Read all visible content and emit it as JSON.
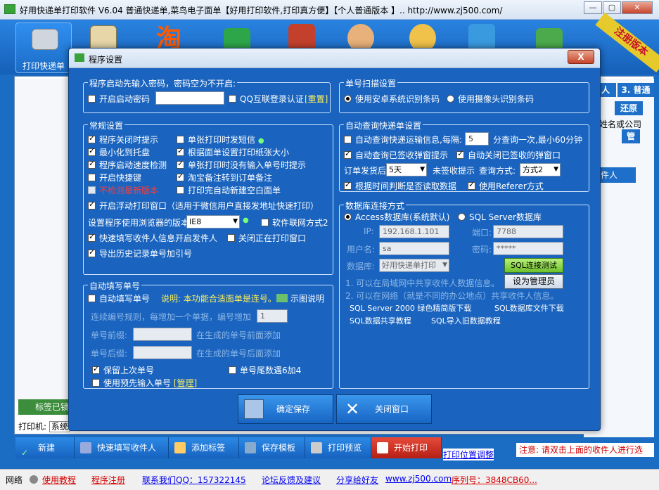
{
  "window": {
    "title": "好用快递单打印软件 V6.04 普通快递单,菜鸟电子面单【好用打印软件,打印真方便】【个人普通版本 】.. http://www.zj500.com/",
    "ribbon": "注册版本"
  },
  "toolbar": {
    "first_label": "打印快递单"
  },
  "right_panel": {
    "tab2": "人",
    "tab3": "3. 普通",
    "restore": "还原",
    "customer_hint": "姓名或公司",
    "manage": "管",
    "recipient": "件人"
  },
  "side": {
    "label": "标签已锁",
    "printer_label": "打印机:",
    "printer_value": "系统"
  },
  "bottom_buttons": [
    "新建",
    "快速填写收件人",
    "添加标签",
    "保存模板",
    "打印预览",
    "开始打印"
  ],
  "print_position_link": "打印位置调整",
  "notice": "注意: 请双击上面的收件人进行选",
  "statusbar": {
    "network": "网络",
    "tutorial": "使用教程",
    "register": "程序注册",
    "qq": "联系我们QQ：157322145",
    "forum": "论坛反馈及建议",
    "share": "分享给好友",
    "site": "www.zj500.com",
    "serial": "序列号：3848CB60..."
  },
  "dialog": {
    "title": "程序设置",
    "close": "X",
    "startup_group": {
      "title": "程序启动先输入密码，密码空为不开启:",
      "enable_password": "开启启动密码",
      "qq_auth": "QQ互联登录认证",
      "reset": "[重置]"
    },
    "scan_group": {
      "title": "单号扫描设置",
      "android": "使用安卓系统识别条码",
      "camera": "使用摄像头识别条码"
    },
    "general_group": {
      "title": "常规设置",
      "items": [
        "程序关闭时提示",
        "单张打印时发短信",
        "最小化到托盘",
        "根据面单设置打印纸张大小",
        "程序启动速度检测",
        "单张打印时没有输入单号时提示",
        "开启快捷键",
        "淘宝备注转到订单备注",
        "不检测最新版本",
        "打印完自动新建空白面单"
      ],
      "float_window": "开启浮动打印窗口（适用于微信用户直接发地址快速打印）",
      "browser_label": "设置程序使用浏览器的版本:",
      "browser_value": "IE8",
      "software_network": "软件联网方式2",
      "fast_fill": "快速填写收件人信息开启发件人",
      "close_print_window": "关闭正在打印窗口",
      "export_history": "导出历史记录单号加引号"
    },
    "auto_query_group": {
      "title": "自动查询快递单设置",
      "auto_query": "自动查询快递运输信息,每隔:",
      "interval": "5",
      "interval_suffix": "分查询一次,最小60分钟",
      "signed_popup": "自动查询已签收弹窗提示",
      "close_signed": "自动关闭已签收的弹窗口",
      "order_after": "订单发货后",
      "days": "5天",
      "unsigned_tip": "未签收提示",
      "query_mode_label": "查询方式:",
      "query_mode": "方式2",
      "by_time": "根据时间判断是否读取数据",
      "referer": "使用Referer方式"
    },
    "db_group": {
      "title": "数据库连接方式",
      "access": "Access数据库(系统默认)",
      "sqlserver": "SQL Server数据库",
      "ip_label": "IP:",
      "ip": "192.168.1.101",
      "port_label": "端口:",
      "port": "7788",
      "user_label": "用户名:",
      "user": "sa",
      "pwd_label": "密码:",
      "pwd": "*****",
      "db_label": "数据库:",
      "db": "好用快递单打印",
      "test": "SQL连接测试",
      "admin": "设为管理员",
      "note1": "1. 可以在局域网中共享收件人数据信息。",
      "note2": "2. 可以在网络（就是不同的办公地点）共享收件人信息。",
      "dl1": "SQL Server 2000 绿色精简版下载",
      "dl2": "SQL数据库文件下载",
      "dl3": "SQL数据共享教程",
      "dl4": "SQL导入旧数据教程"
    },
    "autofill_group": {
      "title": "自动填写单号",
      "enable": "自动填写单号",
      "note": "说明: 本功能合适面单是连号。",
      "example": "示图说明",
      "rule_label": "连续编号规则，每增加一个单据，编号增加",
      "rule_value": "1",
      "prefix_label": "单号前缀:",
      "prefix_hint": "在生成的单号前面添加",
      "suffix_label": "单号后缀:",
      "suffix_hint": "在生成的单号后面添加",
      "keep_last": "保留上次单号",
      "tail_skip4": "单号尾数遇6加4",
      "use_preinput": "使用预先输入单号",
      "manage": "[管理]"
    },
    "save": "确定保存",
    "close_window": "关闭窗口"
  }
}
